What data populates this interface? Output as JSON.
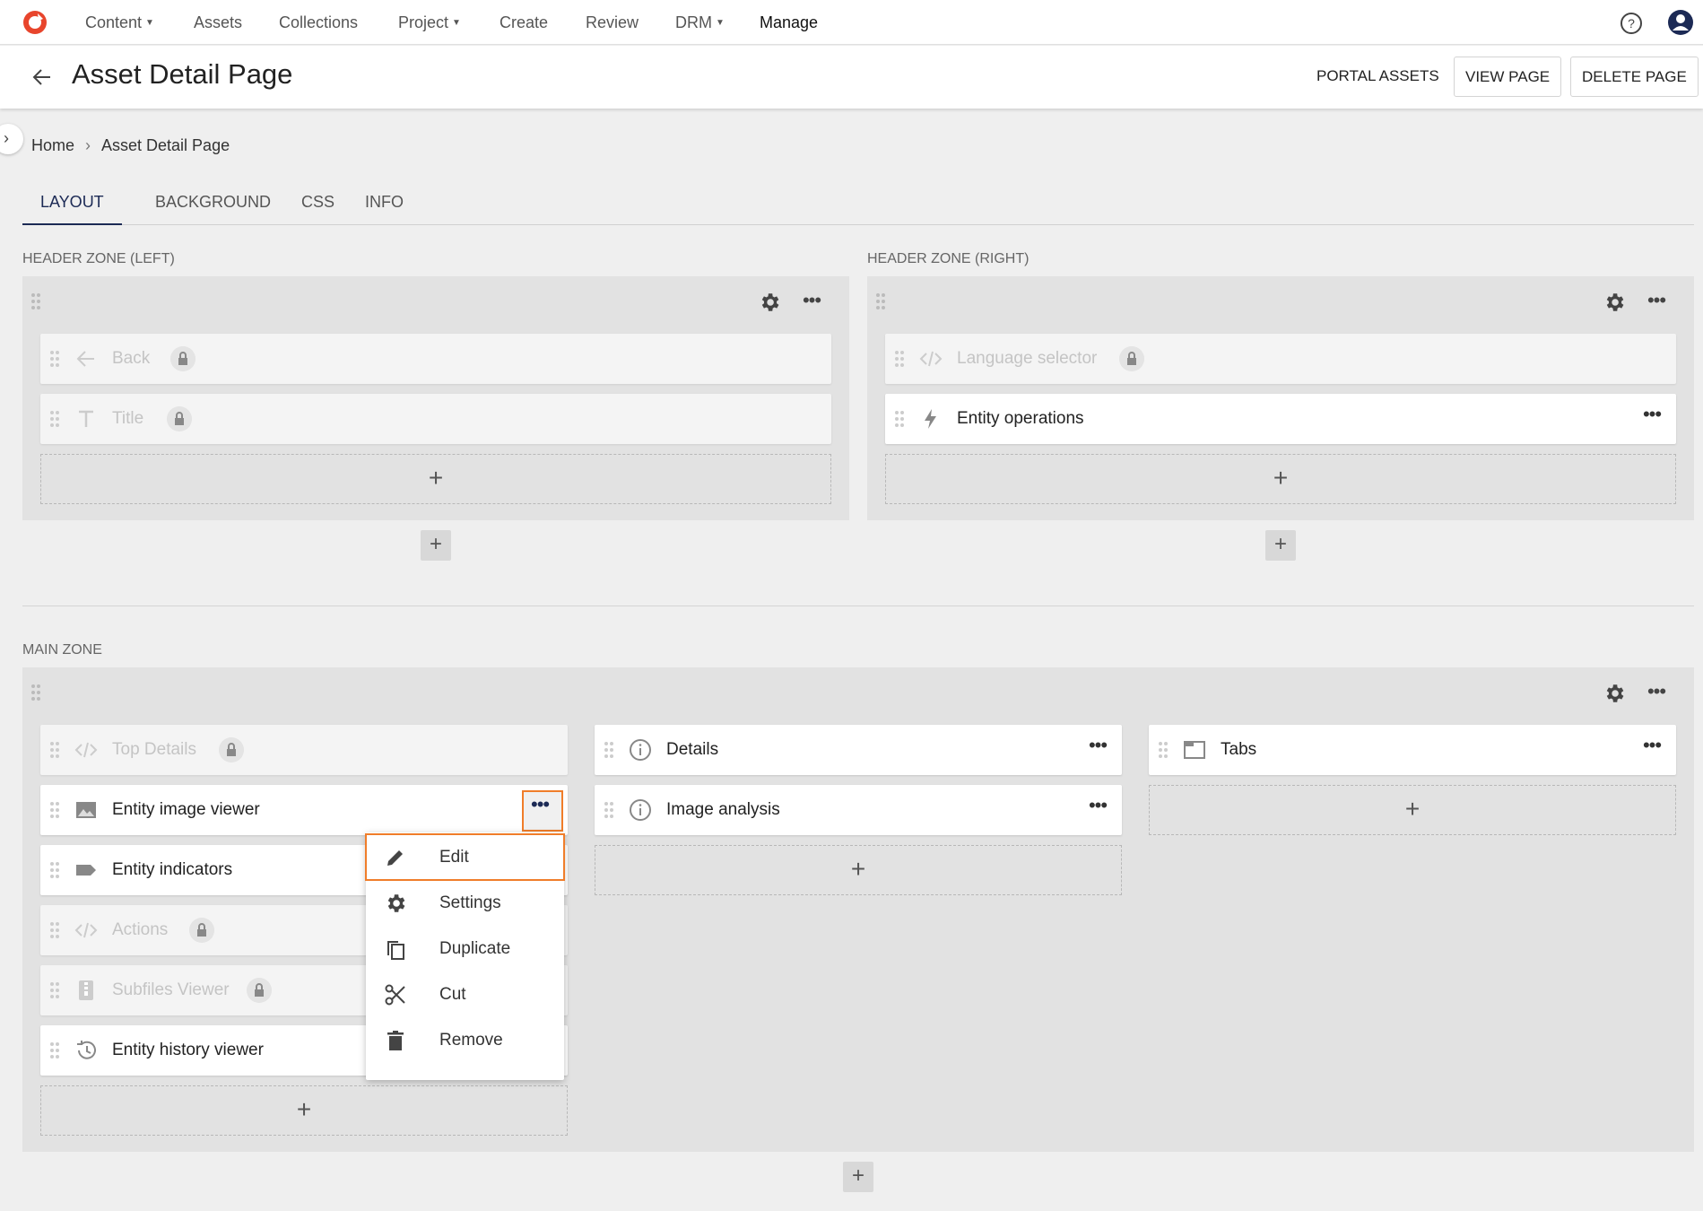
{
  "nav": {
    "items": [
      {
        "label": "Content",
        "dropdown": true
      },
      {
        "label": "Assets",
        "dropdown": false
      },
      {
        "label": "Collections",
        "dropdown": false
      },
      {
        "label": "Project",
        "dropdown": true
      },
      {
        "label": "Create",
        "dropdown": false
      },
      {
        "label": "Review",
        "dropdown": false
      },
      {
        "label": "DRM",
        "dropdown": true
      },
      {
        "label": "Manage",
        "dropdown": false,
        "active": true
      }
    ],
    "icons": {
      "logo": "brand-logo-icon",
      "help": "help-icon",
      "user": "user-avatar-icon"
    },
    "brand_color": "#e8452c"
  },
  "header": {
    "title": "Asset Detail Page",
    "portal_assets": "PORTAL ASSETS",
    "view_page": "VIEW PAGE",
    "delete_page": "DELETE PAGE"
  },
  "breadcrumb": {
    "home": "Home",
    "current": "Asset Detail Page"
  },
  "tabs": [
    {
      "label": "LAYOUT",
      "active": true
    },
    {
      "label": "BACKGROUND",
      "active": false
    },
    {
      "label": "CSS",
      "active": false
    },
    {
      "label": "INFO",
      "active": false
    }
  ],
  "zones": {
    "header_left": {
      "label": "HEADER ZONE (LEFT)",
      "widgets": [
        {
          "label": "Back",
          "icon": "arrow-left-icon",
          "locked": true
        },
        {
          "label": "Title",
          "icon": "text-icon",
          "locked": true
        }
      ]
    },
    "header_right": {
      "label": "HEADER ZONE (RIGHT)",
      "widgets": [
        {
          "label": "Language selector",
          "icon": "code-icon",
          "locked": true
        },
        {
          "label": "Entity operations",
          "icon": "lightning-icon",
          "locked": false
        }
      ]
    },
    "main": {
      "label": "MAIN ZONE",
      "col1": [
        {
          "label": "Top Details",
          "icon": "code-icon",
          "locked": true
        },
        {
          "label": "Entity image viewer",
          "icon": "image-icon",
          "locked": false
        },
        {
          "label": "Entity indicators",
          "icon": "tag-icon",
          "locked": false
        },
        {
          "label": "Actions",
          "icon": "code-icon",
          "locked": true
        },
        {
          "label": "Subfiles Viewer",
          "icon": "zip-file-icon",
          "locked": true
        },
        {
          "label": "Entity history viewer",
          "icon": "history-icon",
          "locked": false
        }
      ],
      "col2": [
        {
          "label": "Details",
          "icon": "info-icon",
          "locked": false
        },
        {
          "label": "Image analysis",
          "icon": "info-icon",
          "locked": false
        }
      ],
      "col3": [
        {
          "label": "Tabs",
          "icon": "tabs-icon",
          "locked": false
        }
      ]
    }
  },
  "context_menu": {
    "items": [
      {
        "label": "Edit",
        "icon": "pencil-icon",
        "highlighted": true
      },
      {
        "label": "Settings",
        "icon": "gear-icon"
      },
      {
        "label": "Duplicate",
        "icon": "duplicate-icon"
      },
      {
        "label": "Cut",
        "icon": "scissors-icon"
      },
      {
        "label": "Remove",
        "icon": "trash-icon"
      }
    ],
    "highlight_color": "#f07d2a"
  }
}
